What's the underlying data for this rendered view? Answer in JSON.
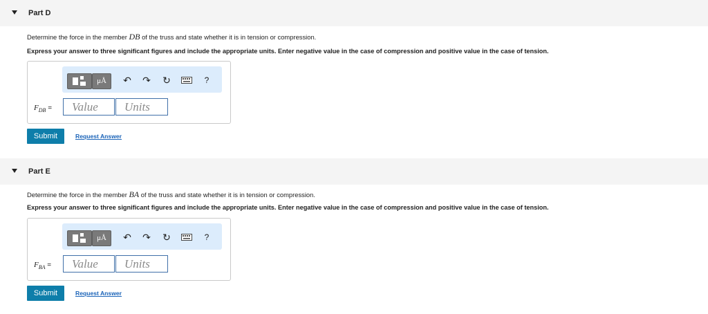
{
  "parts": [
    {
      "title": "Part D",
      "question_pre": "Determine the force in the member ",
      "member": "DB",
      "question_post": " of the truss and state whether it is in tension or compression.",
      "instruction": "Express your answer to three significant figures and include the appropriate units. Enter negative value in the case of compression and positive value in the case of tension.",
      "toolbar": {
        "units_label": "μÅ",
        "undo_icon": "undo-icon",
        "redo_icon": "redo-icon",
        "reset_icon": "reset-icon",
        "keyboard_icon": "keyboard-icon",
        "help_label": "?"
      },
      "variable": "F",
      "subscript": "DB",
      "equals": "=",
      "value_placeholder": "Value",
      "units_placeholder": "Units",
      "submit_label": "Submit",
      "request_label": "Request Answer"
    },
    {
      "title": "Part E",
      "question_pre": "Determine the force in the member ",
      "member": "BA",
      "question_post": " of the truss and state whether it is in tension or compression.",
      "instruction": "Express your answer to three significant figures and include the appropriate units. Enter negative value in the case of compression and positive value in the case of tension.",
      "toolbar": {
        "units_label": "μÅ",
        "undo_icon": "undo-icon",
        "redo_icon": "redo-icon",
        "reset_icon": "reset-icon",
        "keyboard_icon": "keyboard-icon",
        "help_label": "?"
      },
      "variable": "F",
      "subscript": "BA",
      "equals": "=",
      "value_placeholder": "Value",
      "units_placeholder": "Units",
      "submit_label": "Submit",
      "request_label": "Request Answer"
    }
  ],
  "colors": {
    "header_bg": "#f4f4f4",
    "toolbar_bg": "#dcecfc",
    "submit_bg": "#0e7eaa",
    "link": "#1a63b8",
    "field_border": "#3f6fa8"
  }
}
